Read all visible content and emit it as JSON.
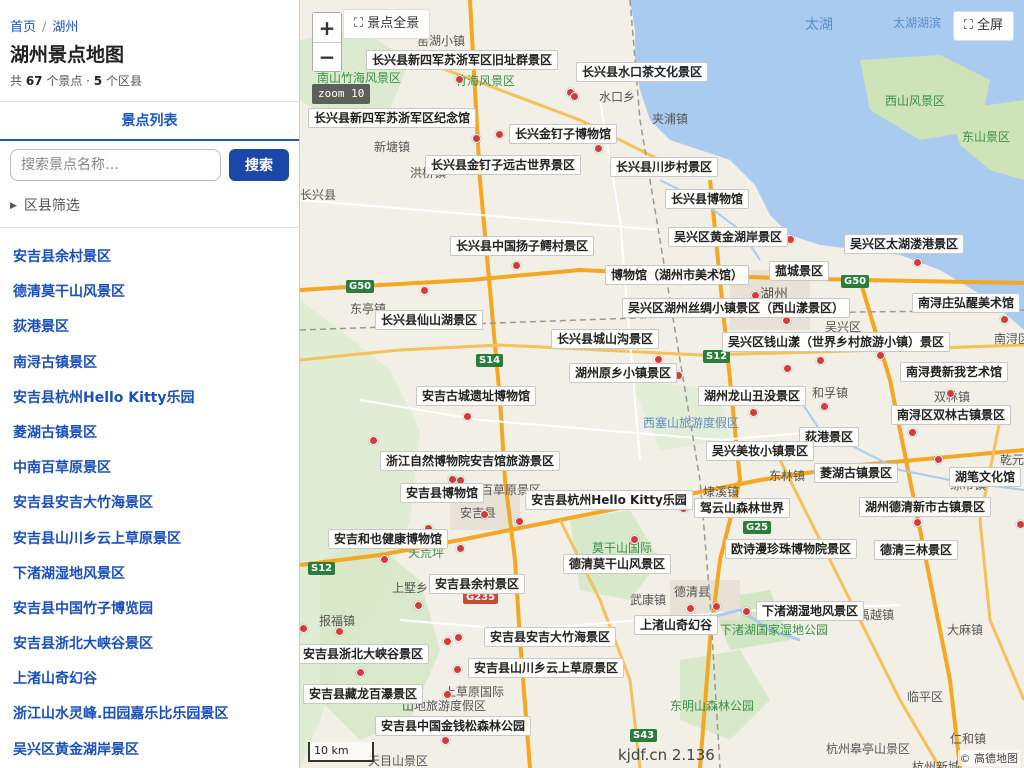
{
  "breadcrumb": {
    "home": "首页",
    "separator": "/",
    "current": "湖州"
  },
  "page_title": "湖州景点地图",
  "summary": {
    "prefix": "共 ",
    "spot_count": "67",
    "spot_unit": " 个景点 · ",
    "district_count": "5",
    "district_unit": " 个区县"
  },
  "tab_label": "景点列表",
  "search": {
    "placeholder": "搜索景点名称…",
    "button": "搜索"
  },
  "filter_label": "区县筛选",
  "spot_list": [
    "安吉县余村景区",
    "德清莫干山风景区",
    "荻港景区",
    "南浔古镇景区",
    "安吉县杭州Hello Kitty乐园",
    "菱湖古镇景区",
    "中南百草原景区",
    "安吉县安吉大竹海景区",
    "安吉县山川乡云上草原景区",
    "下渚湖湿地风景区",
    "安吉县中国竹子博览园",
    "安吉县浙北大峡谷景区",
    "上渚山奇幻谷",
    "浙江山水灵峰.田园嘉乐比乐园景区",
    "吴兴区黄金湖岸景区"
  ],
  "map": {
    "zoom_in": "+",
    "zoom_out": "−",
    "zoom_badge": "zoom 10",
    "view_all": "⛶ 景点全景",
    "fullscreen": "⛶ 全屏",
    "scale": "10 km",
    "version": "kjdf.cn 2.136",
    "copyright": "© 高德地图",
    "colors": {
      "water": "#a8cbef",
      "pin": "#d43a3a",
      "road": "#f5a623"
    },
    "spot_labels": [
      "长兴县新四军苏浙军区旧址群景区",
      "长兴县水口茶文化景区",
      "长兴县新四军苏浙军区纪念馆",
      "长兴金钉子博物馆",
      "长兴县金钉子远古世界景区",
      "长兴县川步村景区",
      "长兴县博物馆",
      "吴兴区黄金湖岸景区",
      "长兴县中国扬子鳄村景区",
      "吴兴区太湖溇港景区",
      "博物馆（湖州市美术馆）",
      "菰城景区",
      "吴兴区湖州丝绸小镇景区（西山漾景区）",
      "南浔庄弘醒美术馆",
      "长兴县仙山湖景区",
      "长兴县城山沟景区",
      "吴兴区钱山漾（世界乡村旅游小镇）景区",
      "湖州原乡小镇景区",
      "南浔费新我艺术馆",
      "安吉古城遗址博物馆",
      "湖州龙山丑没景区",
      "南浔区双林古镇景区",
      "荻港景区",
      "吴兴美妆小镇景区",
      "浙江自然博物院安吉馆旅游景区",
      "菱湖古镇景区",
      "湖笔文化馆",
      "安吉县博物馆",
      "安吉县杭州Hello Kitty乐园",
      "驾云山森林世界",
      "湖州德清新市古镇景区",
      "安吉和也健康博物馆",
      "欧诗漫珍珠博物院景区",
      "德清三林景区",
      "德清莫干山风景区",
      "安吉县余村景区",
      "下渚湖湿地风景区",
      "上渚山奇幻谷",
      "安吉县安吉大竹海景区",
      "安吉县浙北大峡谷景区",
      "安吉县山川乡云上草原景区",
      "安吉县藏龙百瀑景区",
      "安吉县中国金钱松森林公园"
    ],
    "place_labels": [
      "太湖",
      "太湖湖滨",
      "西山风景区",
      "东山景区",
      "窑湖小镇",
      "南山竹海风景区",
      "竹海风景区",
      "水口乡",
      "夹浦镇",
      "新塘镇",
      "洪桥镇",
      "长兴县",
      "东亭镇",
      "湖州",
      "吴兴区",
      "和孚镇",
      "双林镇",
      "东林镇",
      "埭溪镇",
      "莫干山国际",
      "德清县",
      "禹越镇",
      "大麻镇",
      "临平区",
      "杭州皋亭山景区",
      "东明山森林公园",
      "下渚湖国家湿地公园",
      "西塞山旅游度假区",
      "安吉县",
      "上墅乡",
      "报福镇",
      "递铺镇",
      "百草原景区",
      "天荒坪",
      "上草原国际",
      "山地旅游度假区",
      "天目山景区",
      "南浔区",
      "练市镇",
      "乾元镇",
      "武康镇",
      "杭州新城",
      "仁和镇"
    ],
    "road_labels": [
      "G50",
      "G50",
      "S14",
      "S12",
      "S12",
      "G25",
      "G235",
      "S43"
    ]
  }
}
